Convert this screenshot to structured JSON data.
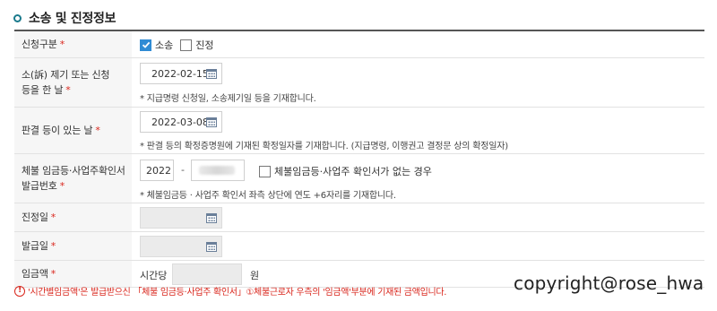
{
  "section": {
    "title": "소송 및 진정정보"
  },
  "rows": {
    "request_type": {
      "label": "신청구분",
      "required": "*",
      "options": [
        {
          "label": "소송",
          "checked": true
        },
        {
          "label": "진정",
          "checked": false
        }
      ]
    },
    "filing_date": {
      "label_line1": "소(訴) 제기 또는 신청",
      "label_line2": "등을 한 날",
      "required": "*",
      "value": "2022-02-15",
      "note": "* 지급명령 신청일, 소송제기일 등을 기재합니다."
    },
    "judgment_date": {
      "label": "판결 등이 있는 날",
      "required": "*",
      "value": "2022-03-08",
      "note": "* 판결 등의 확정증명원에 기재된 확정일자를 기재합니다. (지급명령, 이행권고 결정문 상의 확정일자)"
    },
    "certificate_no": {
      "label_line1": "체불 임금등·사업주확인서",
      "label_line2": "발급번호",
      "required": "*",
      "year": "2022",
      "dash": "-",
      "no_certificate_label": "체불임금등·사업주 확인서가 없는 경우",
      "no_certificate_checked": false,
      "note": "* 체불임금등 · 사업주 확인서 좌측 상단에 연도 +6자리를 기재합니다."
    },
    "petition_date": {
      "label": "진정일",
      "required": "*",
      "value": ""
    },
    "issue_date": {
      "label": "발급일",
      "required": "*",
      "value": ""
    },
    "wage": {
      "label": "임금액",
      "required": "*",
      "prefix": "시간당",
      "value": "",
      "unit": "원"
    }
  },
  "footnote": {
    "icon": "!",
    "text": "'시간별임금액'은 발급받으신 「체불 임금등·사업주 확인서」①체불근로자 우측의 '임금액'부분에 기재된 금액입니다."
  },
  "watermark": "copyright@rose_hwa",
  "colors": {
    "accent": "#1a7a8c",
    "required": "#d9261c",
    "checkbox": "#2f8bd4"
  }
}
